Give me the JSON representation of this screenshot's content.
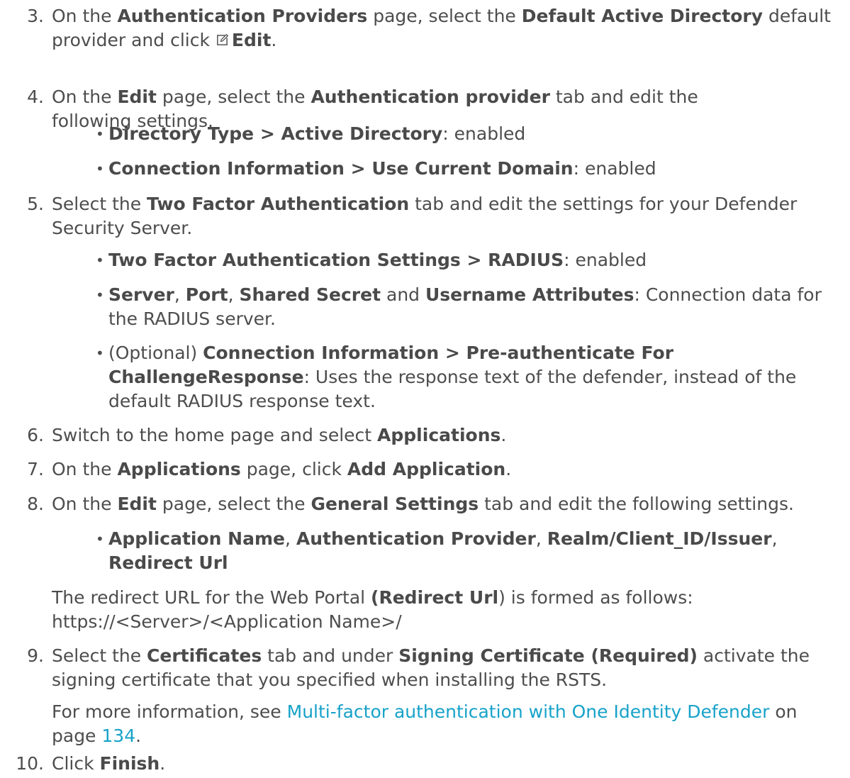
{
  "steps": [
    {
      "num": "3.",
      "parts": [
        {
          "t": "On the "
        },
        {
          "b": "Authentication Providers"
        },
        {
          "t": " page, select the "
        },
        {
          "b": "Default Active Directory"
        },
        {
          "t": " default provider and click "
        },
        {
          "icon": "edit-icon"
        },
        {
          "b": "Edit"
        },
        {
          "t": "."
        }
      ]
    },
    {
      "num": "4.",
      "parts": [
        {
          "t": "On the "
        },
        {
          "b": "Edit"
        },
        {
          "t": " page, select the "
        },
        {
          "b": "Authentication provider"
        },
        {
          "t": " tab and edit the following settings."
        }
      ]
    },
    {
      "num": "5.",
      "parts": [
        {
          "t": "Select the "
        },
        {
          "b": "Two Factor Authentication"
        },
        {
          "t": " tab and edit the settings for your Defender Security Server."
        }
      ]
    },
    {
      "num": "6.",
      "parts": [
        {
          "t": "Switch to the home page and select "
        },
        {
          "b": "Applications"
        },
        {
          "t": "."
        }
      ]
    },
    {
      "num": "7.",
      "parts": [
        {
          "t": "On the "
        },
        {
          "b": "Applications"
        },
        {
          "t": " page, click "
        },
        {
          "b": "Add Application"
        },
        {
          "t": "."
        }
      ]
    },
    {
      "num": "8.",
      "parts": [
        {
          "t": "On the "
        },
        {
          "b": "Edit"
        },
        {
          "t": " page, select the "
        },
        {
          "b": "General Settings"
        },
        {
          "t": " tab and edit the following settings."
        }
      ]
    },
    {
      "num": "9.",
      "parts": [
        {
          "t": "Select the "
        },
        {
          "b": "Certificates"
        },
        {
          "t": " tab and under "
        },
        {
          "b": "Signing Certificate (Required)"
        },
        {
          "t": " activate the signing certificate that you specified when installing the RSTS."
        }
      ]
    },
    {
      "num": "10.",
      "parts": [
        {
          "t": "Click "
        },
        {
          "b": "Finish"
        },
        {
          "t": "."
        }
      ]
    }
  ],
  "bullets": [
    {
      "parts": [
        {
          "b": "Directory Type > Active Directory"
        },
        {
          "t": ": enabled"
        }
      ]
    },
    {
      "parts": [
        {
          "b": "Connection Information > Use Current Domain"
        },
        {
          "t": ": enabled"
        }
      ]
    },
    {
      "parts": [
        {
          "b": "Two Factor Authentication Settings > RADIUS"
        },
        {
          "t": ": enabled"
        }
      ]
    },
    {
      "parts": [
        {
          "b": "Server"
        },
        {
          "t": ", "
        },
        {
          "b": "Port"
        },
        {
          "t": ", "
        },
        {
          "b": "Shared Secret"
        },
        {
          "t": " and "
        },
        {
          "b": "Username Attributes"
        },
        {
          "t": ": Connection data for the RADIUS server."
        }
      ]
    },
    {
      "parts": [
        {
          "t": "(Optional) "
        },
        {
          "b": "Connection Information > Pre-authenticate For ChallengeResponse"
        },
        {
          "t": ": Uses the response text of the defender, instead of the default RADIUS response text."
        }
      ]
    },
    {
      "parts": [
        {
          "b": "Application Name"
        },
        {
          "t": ", "
        },
        {
          "b": "Authentication Provider"
        },
        {
          "t": ", "
        },
        {
          "b": "Realm/Client_ID/Issuer"
        },
        {
          "t": ", "
        },
        {
          "b": "Redirect Url"
        }
      ]
    }
  ],
  "paragraphs": [
    {
      "parts": [
        {
          "t": "The redirect URL for the Web Portal "
        },
        {
          "b": "(Redirect Url"
        },
        {
          "t": ") is formed as follows: https://<Server>/<Application Name>/"
        }
      ]
    },
    {
      "parts": [
        {
          "t": "For more information, see "
        },
        {
          "link": "Multi-factor authentication with One Identity Defender"
        },
        {
          "t": " on page "
        },
        {
          "link": "134"
        },
        {
          "t": "."
        }
      ]
    }
  ]
}
